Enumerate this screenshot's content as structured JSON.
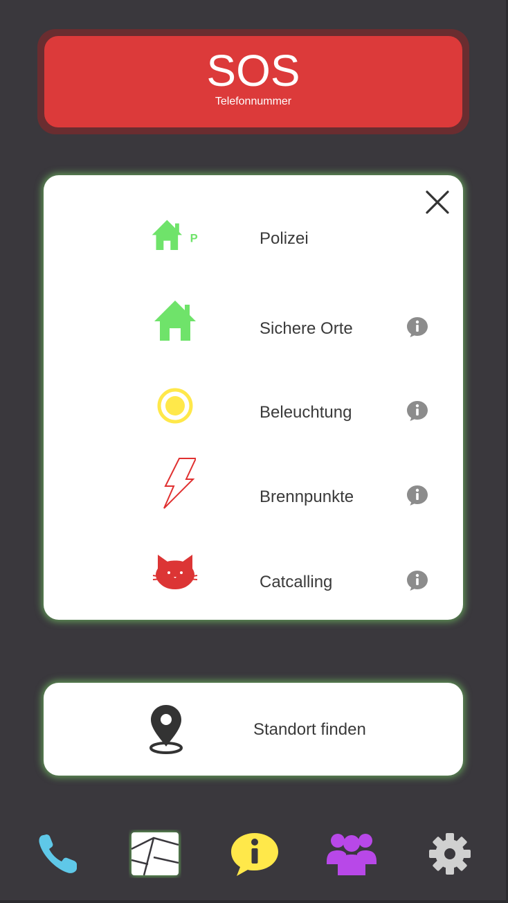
{
  "sos": {
    "title": "SOS",
    "subtitle": "Telefonnummer"
  },
  "layers": {
    "items": [
      {
        "label": "Polizei",
        "icon": "police-house-icon",
        "has_info": false
      },
      {
        "label": "Sichere Orte",
        "icon": "safe-house-icon",
        "has_info": true
      },
      {
        "label": "Beleuchtung",
        "icon": "light-circle-icon",
        "has_info": true
      },
      {
        "label": "Brennpunkte",
        "icon": "lightning-icon",
        "has_info": true
      },
      {
        "label": "Catcalling",
        "icon": "cat-icon",
        "has_info": true
      }
    ],
    "police_badge": "P"
  },
  "locate": {
    "label": "Standort finden",
    "icon": "location-pin-icon"
  },
  "nav": {
    "items": [
      "phone-icon",
      "map-icon",
      "info-chat-icon",
      "community-icon",
      "settings-icon"
    ],
    "info_glyph": "i"
  },
  "colors": {
    "background": "#3a383d",
    "sos_red": "#dc3a3a",
    "green": "#6fe36a",
    "yellow": "#ffe84a",
    "red_outline": "#e03030",
    "cat_red": "#dc3535",
    "info_grey": "#8c8c8c",
    "phone_blue": "#5fc8e8",
    "purple": "#b848e8",
    "gear_grey": "#d0d0d0"
  }
}
